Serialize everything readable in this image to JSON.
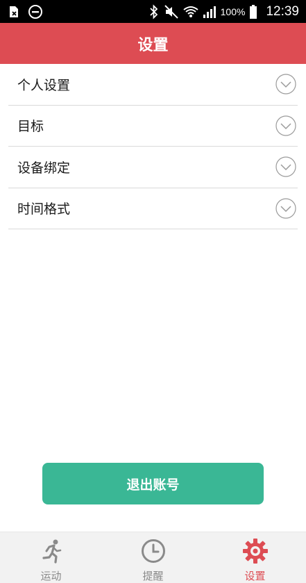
{
  "status_bar": {
    "battery_text": "100%",
    "time": "12:39",
    "icons": [
      "sim-card-icon",
      "do-not-disturb-icon",
      "bluetooth-icon",
      "mute-icon",
      "wifi-icon",
      "signal-icon",
      "battery-icon"
    ]
  },
  "header": {
    "title": "设置"
  },
  "settings": {
    "items": [
      {
        "label": "个人设置",
        "icon": "chevron-down-icon"
      },
      {
        "label": "目标",
        "icon": "chevron-down-icon"
      },
      {
        "label": "设备绑定",
        "icon": "chevron-down-icon"
      },
      {
        "label": "时间格式",
        "icon": "chevron-down-icon"
      }
    ]
  },
  "logout": {
    "label": "退出账号"
  },
  "bottom_nav": {
    "items": [
      {
        "label": "运动",
        "icon": "running-man-icon",
        "active": false
      },
      {
        "label": "提醒",
        "icon": "clock-icon",
        "active": false
      },
      {
        "label": "设置",
        "icon": "gear-icon",
        "active": true
      }
    ]
  },
  "colors": {
    "header": "#dd4c53",
    "accent": "#dd4c53",
    "button": "#3ab795",
    "nav_inactive": "#8a8a8a"
  }
}
